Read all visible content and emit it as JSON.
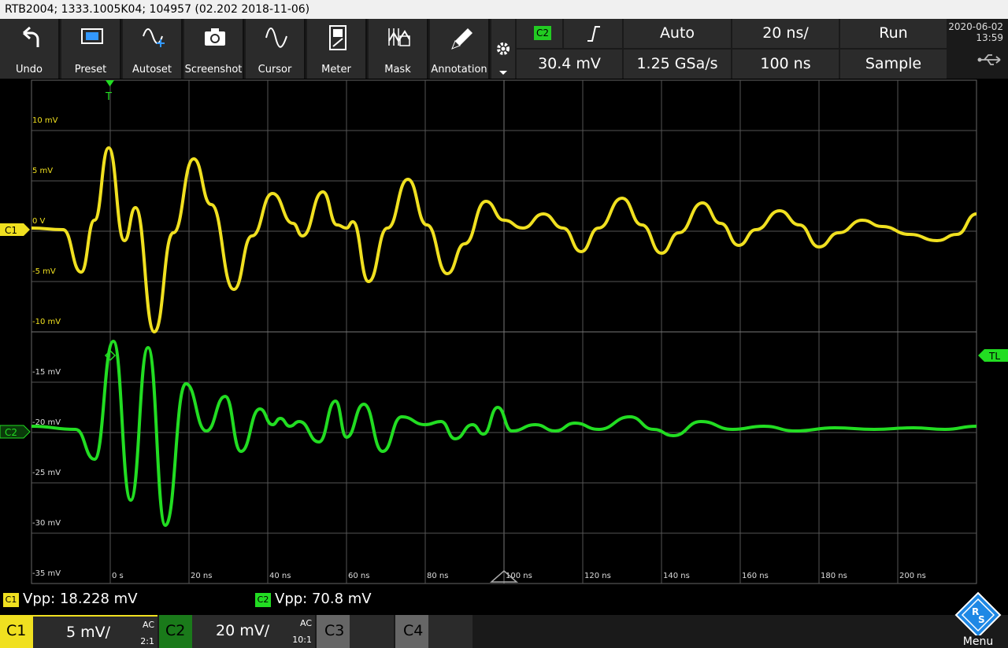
{
  "title": "RTB2004; 1333.1005K04; 104957 (02.202 2018-11-06)",
  "toolbar": {
    "undo": "Undo",
    "preset": "Preset",
    "autoset": "Autoset",
    "screenshot": "Screenshot",
    "cursor": "Cursor",
    "meter": "Meter",
    "mask": "Mask",
    "annotation": "Annotation"
  },
  "trigger": {
    "source": "C2",
    "level": "30.4 mV",
    "mode": "Auto",
    "sample_rate": "1.25 GSa/s",
    "time_scale": "20 ns/",
    "position": "100 ns",
    "run_state": "Run",
    "acquisition": "Sample"
  },
  "datetime": {
    "date": "2020-06-02",
    "time": "13:59"
  },
  "grid": {
    "c1_labels": [
      "10 mV",
      "5 mV",
      "0 V",
      "-5 mV",
      "-10 mV"
    ],
    "c2_labels": [
      "-15 mV",
      "-20 mV",
      "-25 mV",
      "-30 mV",
      "-35 mV"
    ],
    "time_labels": [
      "0 s",
      "20 ns",
      "40 ns",
      "60 ns",
      "80 ns",
      "100 ns",
      "120 ns",
      "140 ns",
      "160 ns",
      "180 ns",
      "200 ns"
    ],
    "marker_c1": "C1",
    "marker_c2": "C2",
    "marker_tl": "TL",
    "marker_t": "T"
  },
  "measurements": {
    "c1_tag": "C1",
    "c1_value": "Vpp: 18.228 mV",
    "c2_tag": "C2",
    "c2_value": "Vpp: 70.8 mV"
  },
  "channels": {
    "c1": {
      "label": "C1",
      "scale": "5 mV/",
      "coupling": "AC",
      "probe": "2:1"
    },
    "c2": {
      "label": "C2",
      "scale": "20 mV/",
      "coupling": "AC",
      "probe": "10:1"
    },
    "c3": {
      "label": "C3"
    },
    "c4": {
      "label": "C4"
    }
  },
  "menu": "Menu",
  "colors": {
    "c1": "#f0e020",
    "c2": "#22dd22",
    "grid": "#555555"
  }
}
